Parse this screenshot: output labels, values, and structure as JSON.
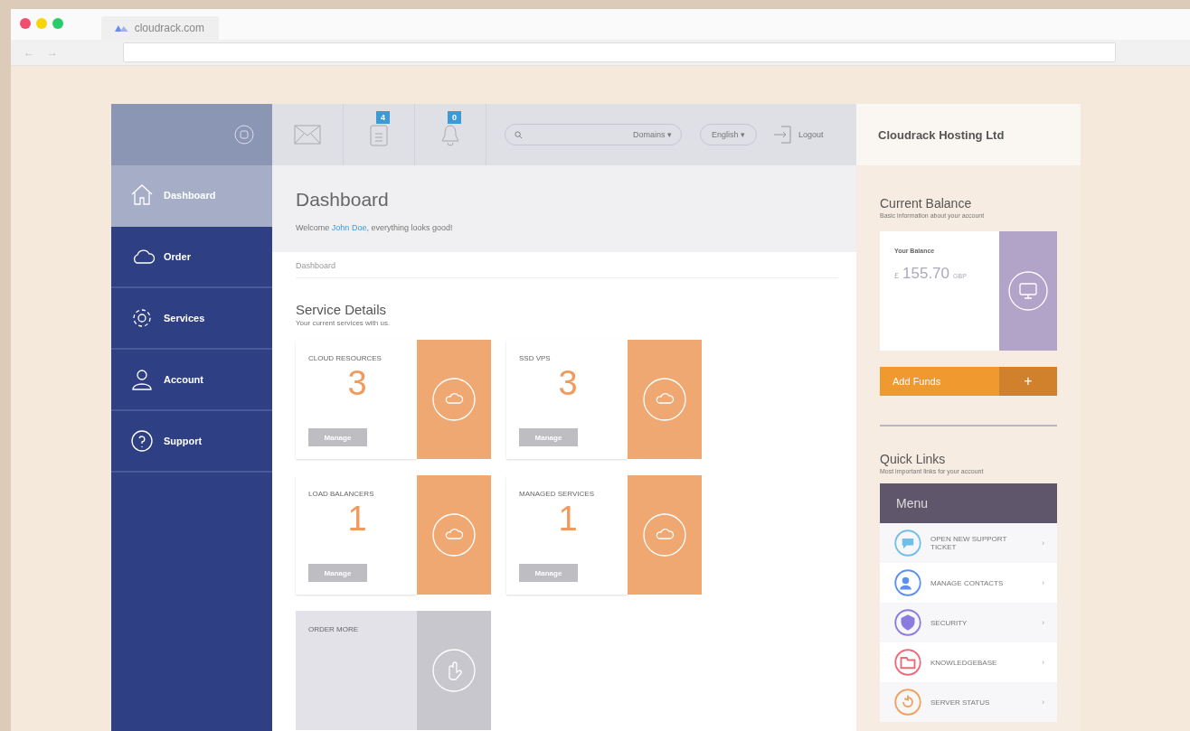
{
  "browser": {
    "tab_title": "cloudrack.com",
    "back": "←",
    "forward": "→"
  },
  "sidebar": {
    "items": [
      {
        "label": "Dashboard",
        "selected": true
      },
      {
        "label": "Order",
        "selected": false
      },
      {
        "label": "Services",
        "selected": false
      },
      {
        "label": "Account",
        "selected": false
      },
      {
        "label": "Support",
        "selected": false
      }
    ]
  },
  "header": {
    "tasks_badge": "4",
    "notifications_badge": "0",
    "search": {
      "scope": "Domains",
      "caret": "▾"
    },
    "language": "English",
    "language_caret": "▾",
    "logout": "Logout"
  },
  "page": {
    "title": "Dashboard",
    "welcome_before": "Welcome ",
    "user_name": "John Doe",
    "welcome_after": ", everything looks good!",
    "breadcrumb": "Dashboard"
  },
  "services": {
    "title": "Service Details",
    "subtitle": "Your current services with us.",
    "cards": [
      {
        "kind": "service",
        "name": "CLOUD RESOURCES",
        "count": "3",
        "button": "Manage"
      },
      {
        "kind": "service",
        "name": "SSD VPS",
        "count": "3",
        "button": "Manage"
      },
      {
        "kind": "service",
        "name": "LOAD BALANCERS",
        "count": "1",
        "button": "Manage"
      },
      {
        "kind": "service",
        "name": "MANAGED SERVICES",
        "count": "1",
        "button": "Manage"
      },
      {
        "kind": "order",
        "name": "ORDER MORE"
      }
    ]
  },
  "right": {
    "company": "Cloudrack Hosting Ltd",
    "balance_title": "Current Balance",
    "balance_subtitle": "Basic information about your account",
    "balance_label": "Your Balance",
    "currency_symbol": "£",
    "amount": "155.70",
    "currency": "GBP",
    "add_funds": "Add Funds",
    "add_symbol": "+",
    "links_title": "Quick Links",
    "links_subtitle": "Most important links for your account",
    "menu_title": "Menu",
    "links": [
      {
        "label": "OPEN NEW SUPPORT TICKET",
        "color": "#6fc0e8",
        "chevron": "›"
      },
      {
        "label": "MANAGE CONTACTS",
        "color": "#5b8ff0",
        "chevron": "›"
      },
      {
        "label": "SECURITY",
        "color": "#8a7be0",
        "chevron": "›"
      },
      {
        "label": "KNOWLEDGEBASE",
        "color": "#ee6a7a",
        "chevron": "›"
      },
      {
        "label": "SERVER STATUS",
        "color": "#f0a05a",
        "chevron": "›"
      }
    ]
  }
}
